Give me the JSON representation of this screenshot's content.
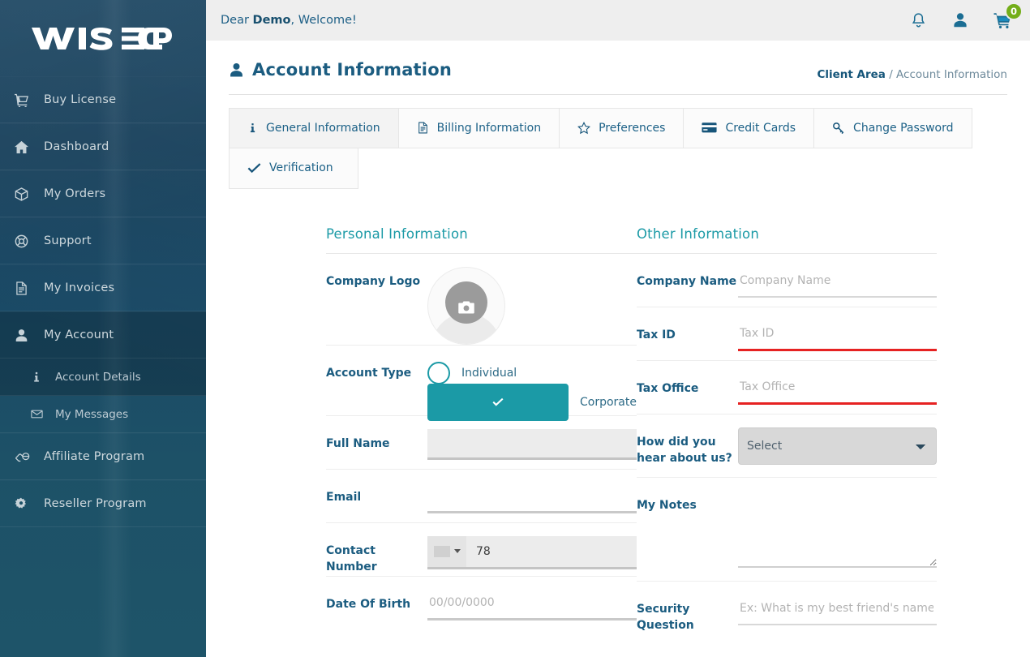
{
  "brand": {
    "logo_text": "WISECP"
  },
  "sidebar": {
    "items": [
      {
        "label": "Buy License",
        "icon": "cart-icon"
      },
      {
        "label": "Dashboard",
        "icon": "home-icon"
      },
      {
        "label": "My Orders",
        "icon": "box-icon"
      },
      {
        "label": "Support",
        "icon": "lifebuoy-icon"
      },
      {
        "label": "My Invoices",
        "icon": "file-icon"
      },
      {
        "label": "My Account",
        "icon": "user-icon"
      }
    ],
    "sub_items": [
      {
        "label": "Account Details",
        "icon": "info-icon"
      },
      {
        "label": "My Messages",
        "icon": "envelope-icon"
      }
    ],
    "items_after": [
      {
        "label": "Affiliate Program",
        "icon": "handshake-icon"
      },
      {
        "label": "Reseller Program",
        "icon": "gear-icon"
      }
    ]
  },
  "topbar": {
    "greeting_prefix": "Dear ",
    "user": "Demo",
    "greeting_suffix": ", Welcome!",
    "cart_count": "0"
  },
  "page": {
    "title": "Account Information",
    "breadcrumb_root": "Client Area",
    "breadcrumb_current": "/ Account Information"
  },
  "tabs": [
    {
      "label": "General Information",
      "icon": "info-icon",
      "active": true
    },
    {
      "label": "Billing Information",
      "icon": "file-icon",
      "active": false
    },
    {
      "label": "Preferences",
      "icon": "star-icon",
      "active": false
    },
    {
      "label": "Credit Cards",
      "icon": "credit-card-icon",
      "active": false
    },
    {
      "label": "Change Password",
      "icon": "key-icon",
      "active": false
    },
    {
      "label": "Verification",
      "icon": "check-icon",
      "active": false
    }
  ],
  "personal": {
    "section_title": "Personal Information",
    "company_logo_label": "Company Logo",
    "account_type_label": "Account Type",
    "account_type_options": [
      {
        "label": "Individual",
        "selected": false
      },
      {
        "label": "Corporate",
        "selected": true
      }
    ],
    "full_name_label": "Full Name",
    "full_name_value": "",
    "email_label": "Email",
    "email_value": "",
    "contact_label": "Contact Number",
    "contact_value": "78",
    "dob_label": "Date Of Birth",
    "dob_placeholder": "00/00/0000"
  },
  "other": {
    "section_title": "Other Information",
    "company_name_label": "Company Name",
    "company_name_placeholder": "Company Name",
    "tax_id_label": "Tax ID",
    "tax_id_placeholder": "Tax ID",
    "tax_office_label": "Tax Office",
    "tax_office_placeholder": "Tax Office",
    "hear_label": "How did you hear about us?",
    "hear_value": "Select",
    "notes_label": "My Notes",
    "notes_value": "",
    "security_label": "Security Question",
    "security_placeholder": "Ex: What is my best friend's name?"
  },
  "colors": {
    "sidebar_top": "#1b4561",
    "sidebar_bottom": "#1e5469",
    "accent_teal": "#1b9aa6",
    "heading_blue": "#1b5c80",
    "badge_green": "#74ae19",
    "error_red": "#e62222"
  }
}
